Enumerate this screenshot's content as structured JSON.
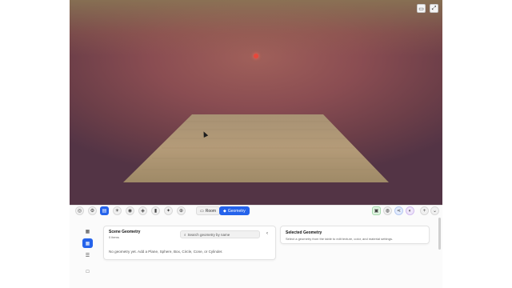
{
  "toolbar": {
    "tabs": [
      {
        "label": "Room",
        "icon": "bed-icon"
      },
      {
        "label": "Geometry",
        "icon": "shapes-icon"
      }
    ]
  },
  "scene_geometry": {
    "title": "Scene Geometry",
    "count": "0 items",
    "search_placeholder": "Search geometry by name",
    "empty_message": "No geometry yet. Add a Plane, Sphere, Box, Circle, Cone, or Cylinder."
  },
  "selected_geometry": {
    "title": "Selected Geometry",
    "hint": "Select a geometry from the table to edit texture, color, and material settings."
  },
  "colors": {
    "accent": "#2563eb",
    "sun": "#e8473b"
  }
}
